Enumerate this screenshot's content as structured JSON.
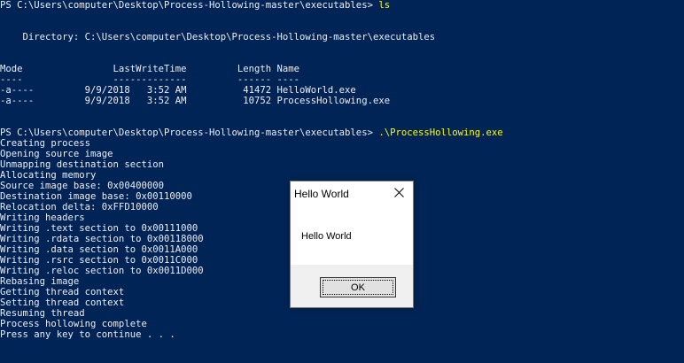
{
  "console": {
    "prompt1": "PS C:\\Users\\computer\\Desktop\\Process-Hollowing-master\\executables> ",
    "cmd1": "ls",
    "directory": "    Directory: C:\\Users\\computer\\Desktop\\Process-Hollowing-master\\executables",
    "header": "Mode                LastWriteTime         Length Name",
    "separator": "----                -------------         ------ ----",
    "files": [
      "-a----         9/9/2018   3:52 AM          41472 HelloWorld.exe",
      "-a----         9/9/2018   3:52 AM          10752 ProcessHollowing.exe"
    ],
    "prompt2": "PS C:\\Users\\computer\\Desktop\\Process-Hollowing-master\\executables> ",
    "cmd2": ".\\ProcessHollowing.exe",
    "output": [
      "Creating process",
      "Opening source image",
      "Unmapping destination section",
      "Allocating memory",
      "Source image base: 0x00400000",
      "Destination image base: 0x00110000",
      "Relocation delta: 0xFFD10000",
      "Writing headers",
      "Writing .text section to 0x00111000",
      "Writing .rdata section to 0x00118000",
      "Writing .data section to 0x0011A000",
      "Writing .rsrc section to 0x0011C000",
      "Writing .reloc section to 0x0011D000",
      "Rebasing image",
      "Getting thread context",
      "Setting thread context",
      "Resuming thread",
      "Process hollowing complete",
      "Press any key to continue . . ."
    ]
  },
  "dialog": {
    "title": "Hello World",
    "message": "Hello World",
    "ok_label": "OK",
    "close_icon": "close-icon"
  },
  "colors": {
    "console_background": "#012456",
    "console_text": "#eeedf0",
    "command_text": "#ffff00"
  }
}
